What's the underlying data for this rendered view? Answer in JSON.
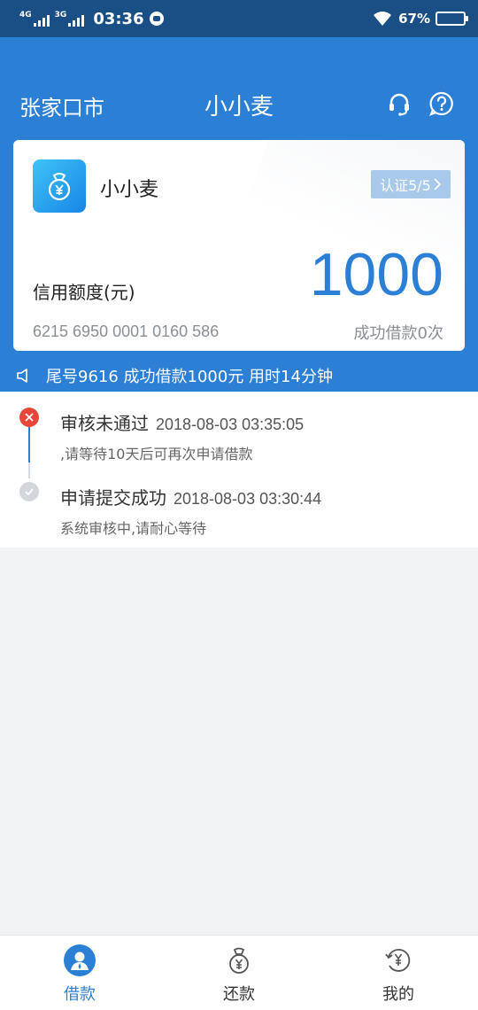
{
  "status_bar": {
    "net1": "4G",
    "net2": "3G",
    "time": "03:36",
    "battery_pct": "67%",
    "battery_level": 0.67
  },
  "header": {
    "city": "张家口市",
    "title": "小小麦",
    "icons": [
      "headset-icon",
      "help-icon"
    ]
  },
  "card": {
    "product_name": "小小麦",
    "auth_badge": "认证5/5",
    "limit_label": "信用额度(元)",
    "limit_value": "1000",
    "card_number": "6215 6950 0001 0160 586",
    "loan_count": "成功借款0次"
  },
  "notice": {
    "text": "尾号9616 成功借款1000元 用时14分钟"
  },
  "timeline": [
    {
      "status": "rejected",
      "title": "审核未通过",
      "time": "2018-08-03 03:35:05",
      "desc": ",请等待10天后可再次申请借款"
    },
    {
      "status": "done",
      "title": "申请提交成功",
      "time": "2018-08-03 03:30:44",
      "desc": "系统审核中,请耐心等待"
    }
  ],
  "bottom_nav": [
    {
      "label": "借款",
      "active": true
    },
    {
      "label": "还款",
      "active": false
    },
    {
      "label": "我的",
      "active": false
    }
  ],
  "colors": {
    "status_bar": "#1a4f86",
    "primary": "#2b7fd4",
    "rejected": "#e8463a",
    "done": "#d3d6db"
  }
}
